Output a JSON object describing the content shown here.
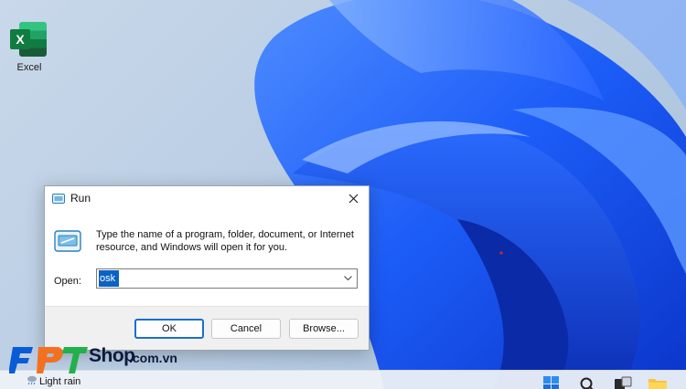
{
  "desktop": {
    "icons": [
      {
        "label": "Excel",
        "icon": "excel-icon"
      }
    ]
  },
  "run_dialog": {
    "title": "Run",
    "instructions": "Type the name of a program, folder, document, or Internet resource, and Windows will open it for you.",
    "open_label": "Open:",
    "open_value": "osk",
    "buttons": {
      "ok": "OK",
      "cancel": "Cancel",
      "browse": "Browse..."
    }
  },
  "watermark": {
    "brand": "FPT",
    "shop": "Shop",
    "domain": ".com.vn"
  },
  "taskbar": {
    "weather": "Light rain",
    "icons": [
      "start-icon",
      "search-icon",
      "task-view-icon",
      "file-explorer-icon"
    ]
  },
  "colors": {
    "accent": "#0067c0",
    "wallpaper_blue": "#1f5bff",
    "fpt_blue": "#0a5bd6",
    "fpt_orange": "#f37021",
    "fpt_green": "#22b04b"
  }
}
